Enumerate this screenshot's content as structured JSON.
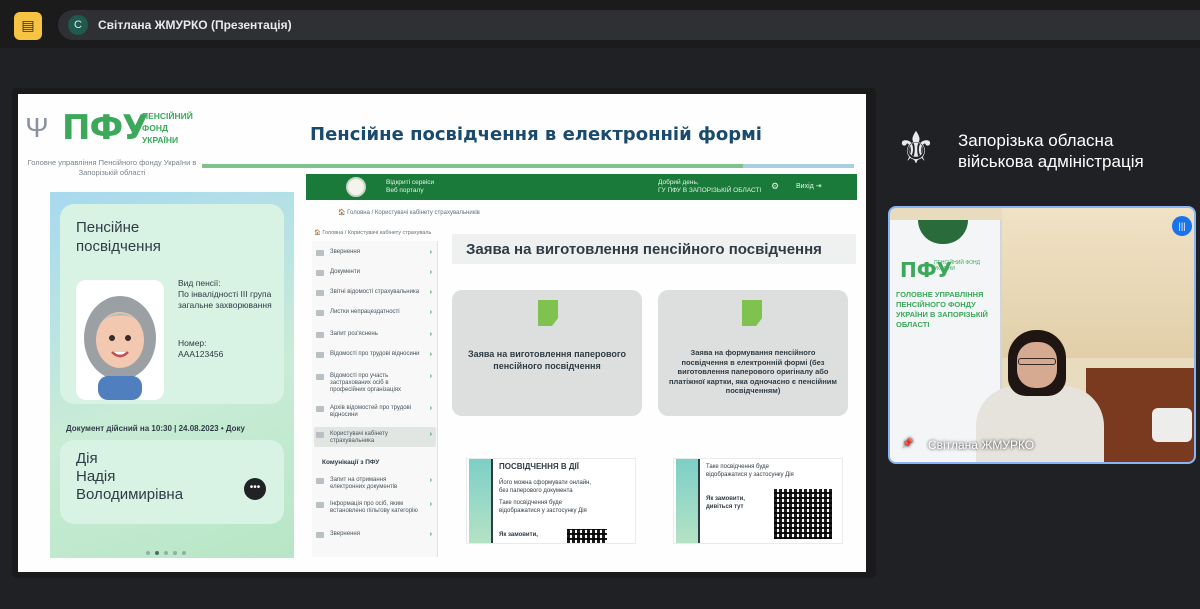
{
  "window": {
    "app_icon": "document-presentation-icon",
    "presenter_initial": "С",
    "presenter_title": "Світлана ЖМУРКО (Презентація)"
  },
  "slide": {
    "title": "Пенсійне посвідчення в електронній формі",
    "logo": {
      "word": "ПФУ",
      "tagline": "ПЕНСІЙНИЙ ФОНД УКРАЇНИ",
      "sub": "Головне управління Пенсійного фонду України в Запорізькій області"
    },
    "card": {
      "title": "Пенсійне посвідчення",
      "pension_type_label": "Вид пенсії:",
      "pension_type_value": "По інвалідності ІІІ група загальне захворювання",
      "number_label": "Номер:",
      "number_value": "ААА123456",
      "valid_text": "Документ дійсний на 10:30 | 24.08.2023 • Доку",
      "name_line1": "Дія",
      "name_line2": "Надія",
      "name_line3": "Володимирівна",
      "more_label": "•••"
    },
    "site": {
      "name_line1": "Відкриті сервіси",
      "name_line2": "Веб порталу",
      "greet_line1": "Добрий день,",
      "greet_line2": "ГУ ПФУ В ЗАПОРІЗЬКІЙ ОБЛАСТІ",
      "gear": "⚙",
      "login": "Вихід ⇥",
      "crumb_top": "🏠 Головна / Користувачі кабінету страхувальників",
      "crumb_side": "🏠 Головна / Користувачі кабінету страхуваль",
      "menu": [
        "Звернення",
        "Документи",
        "Звітні відомості страхувальника",
        "Листки непрацездатності",
        "Запит роз'яснень",
        "Відомості про трудові відносини",
        "Відомості про участь застрахованих осіб в професійних організаціях",
        "Архів відомостей про трудові відносини",
        "Користувачі кабінету страхувальника"
      ],
      "menu_chev": "›",
      "section_title": "Комунікації з ПФУ",
      "menu2": [
        "Запит на отримання електронних документів",
        "Інформація про осіб, яким встановлено пільгову категорію",
        "Звернення"
      ],
      "main_heading": "Заява на виготовлення пенсійного посвідчення",
      "option1": "Заява на виготовлення паперового пенсійного посвідчення",
      "option2": "Заява на формування пенсійного посвідчення в електронній формі (без виготовлення паперового оригіналу або платіжної картки, яка одночасно є пенсійним посвідченням)",
      "promo1_title": "ПОСВІДЧЕННЯ В ДІЇ",
      "promo1_text1": "Його можна сформувати онлайн, без паперового документа",
      "promo1_text2": "Таке посвідчення буде відображатися у застосунку Дія",
      "promo1_text3": "Як замовити,",
      "promo2_text1": "Таке посвідчення буде відображатися у застосунку Дія",
      "promo2_text2": "Як замовити, дивіться тут"
    }
  },
  "brand": {
    "line1": "Запорізька обласна",
    "line2": "військова адміністрація"
  },
  "camera": {
    "participant_name": "Світлана ЖМУРКО",
    "banner_pfu": "ПФУ",
    "banner_mini": "ПЕНСІЙНИЙ ФОНД УКРАЇНИ",
    "banner_text": "ГОЛОВНЕ УПРАВЛІННЯ ПЕНСІЙНОГО ФОНДУ УКРАЇНИ В ЗАПОРІЗЬКІЙ ОБЛАСТІ"
  },
  "colors": {
    "accent_green": "#3ba85a",
    "site_header": "#1a7a3a",
    "speaking_border": "#8ab4f8"
  }
}
